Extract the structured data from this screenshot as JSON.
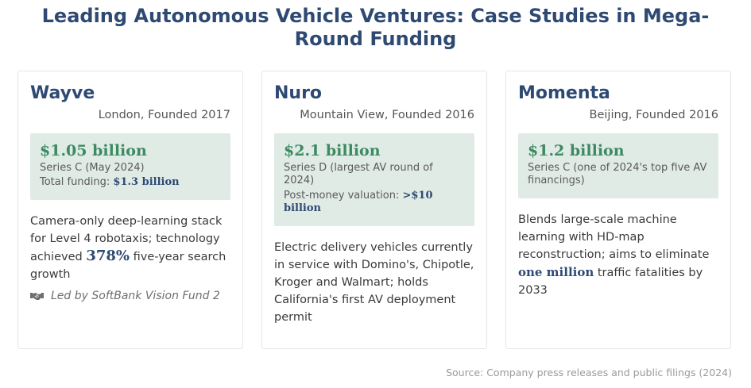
{
  "title": "Leading Autonomous Vehicle Ventures: Case Studies in Mega-Round Funding",
  "cards": [
    {
      "name": "Wayve",
      "location": "London, Founded 2017",
      "amount": "$1.05 billion",
      "round": "Series C (May 2024)",
      "extra_label": "Total funding: ",
      "extra_value": "$1.3 billion",
      "desc_pre": "Camera-only deep-learning stack for Level 4 robotaxis; technology achieved ",
      "desc_highlight": "378%",
      "desc_post": " five-year search growth",
      "lead_icon": "handshake-icon",
      "lead": "Led by SoftBank Vision Fund 2"
    },
    {
      "name": "Nuro",
      "location": "Mountain View, Founded 2016",
      "amount": "$2.1 billion",
      "round": "Series D (largest AV round of 2024)",
      "extra_label": "Post-money valuation: ",
      "extra_value": ">$10 billion",
      "desc": "Electric delivery vehicles currently in service with Domino's, Chipotle, Kroger and Walmart; holds California's first AV deployment permit"
    },
    {
      "name": "Momenta",
      "location": "Beijing, Founded 2016",
      "amount": "$1.2 billion",
      "round": "Series C (one of 2024's top five AV financings)",
      "desc_pre": "Blends large-scale machine learning with HD-map reconstruction; aims to eliminate ",
      "desc_highlight": "one million",
      "desc_post": " traffic fatalities by 2033"
    }
  ],
  "source": "Source: Company press releases and public filings (2024)",
  "colors": {
    "title": "#2e4a72",
    "amount": "#3d8a62",
    "fund_box": "#e0ebe6"
  }
}
